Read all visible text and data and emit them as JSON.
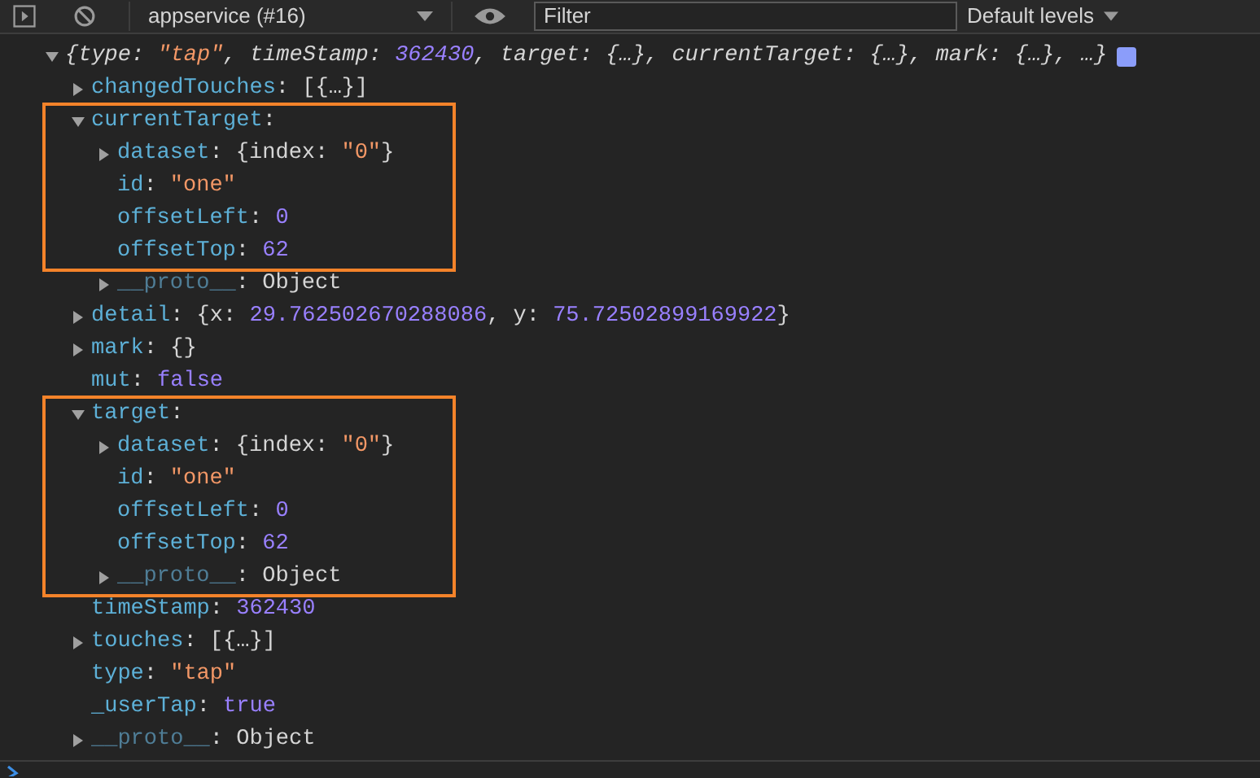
{
  "toolbar": {
    "context": "appservice (#16)",
    "filter": {
      "placeholder": "Filter"
    },
    "levels": "Default levels"
  },
  "entry": {
    "expanded": true,
    "summary": [
      {
        "kind": "punct",
        "text": "{"
      },
      {
        "kind": "key",
        "text": "type"
      },
      {
        "kind": "punct",
        "text": ": "
      },
      {
        "kind": "string",
        "text": "\"tap\""
      },
      {
        "kind": "punct",
        "text": ", "
      },
      {
        "kind": "key",
        "text": "timeStamp"
      },
      {
        "kind": "punct",
        "text": ": "
      },
      {
        "kind": "number",
        "text": "362430"
      },
      {
        "kind": "punct",
        "text": ", "
      },
      {
        "kind": "key",
        "text": "target"
      },
      {
        "kind": "punct",
        "text": ": {…}, "
      },
      {
        "kind": "key",
        "text": "currentTarget"
      },
      {
        "kind": "punct",
        "text": ": {…}, "
      },
      {
        "kind": "key",
        "text": "mark"
      },
      {
        "kind": "punct",
        "text": ": {…}, …}"
      }
    ],
    "properties": [
      {
        "kind": "object",
        "expanded": false,
        "boxed": false,
        "tokens": [
          {
            "kind": "key",
            "text": "changedTouches"
          },
          {
            "kind": "punct",
            "text": ": [{…}]"
          }
        ]
      },
      {
        "kind": "object",
        "expanded": true,
        "boxed": true,
        "tokens": [
          {
            "kind": "key",
            "text": "currentTarget"
          },
          {
            "kind": "punct",
            "text": ":"
          }
        ],
        "children": [
          {
            "kind": "object",
            "expanded": false,
            "boxed": true,
            "tokens": [
              {
                "kind": "key",
                "text": "dataset"
              },
              {
                "kind": "punct",
                "text": ": {index: "
              },
              {
                "kind": "string",
                "text": "\"0\""
              },
              {
                "kind": "punct",
                "text": "}"
              }
            ]
          },
          {
            "kind": "primitive",
            "boxed": true,
            "tokens": [
              {
                "kind": "key",
                "text": "id"
              },
              {
                "kind": "punct",
                "text": ": "
              },
              {
                "kind": "string",
                "text": "\"one\""
              }
            ]
          },
          {
            "kind": "primitive",
            "boxed": true,
            "tokens": [
              {
                "kind": "key",
                "text": "offsetLeft"
              },
              {
                "kind": "punct",
                "text": ": "
              },
              {
                "kind": "number",
                "text": "0"
              }
            ]
          },
          {
            "kind": "primitive",
            "boxed": true,
            "tokens": [
              {
                "kind": "key",
                "text": "offsetTop"
              },
              {
                "kind": "punct",
                "text": ": "
              },
              {
                "kind": "number",
                "text": "62"
              }
            ]
          },
          {
            "kind": "object",
            "expanded": false,
            "boxed": false,
            "tokens": [
              {
                "kind": "internal",
                "text": "__proto__"
              },
              {
                "kind": "punct",
                "text": ": Object"
              }
            ]
          }
        ]
      },
      {
        "kind": "object",
        "expanded": false,
        "boxed": false,
        "tokens": [
          {
            "kind": "key",
            "text": "detail"
          },
          {
            "kind": "punct",
            "text": ": {x: "
          },
          {
            "kind": "number",
            "text": "29.762502670288086"
          },
          {
            "kind": "punct",
            "text": ", y: "
          },
          {
            "kind": "number",
            "text": "75.72502899169922"
          },
          {
            "kind": "punct",
            "text": "}"
          }
        ]
      },
      {
        "kind": "object",
        "expanded": false,
        "boxed": false,
        "tokens": [
          {
            "kind": "key",
            "text": "mark"
          },
          {
            "kind": "punct",
            "text": ": {}"
          }
        ]
      },
      {
        "kind": "primitive",
        "boxed": false,
        "tokens": [
          {
            "kind": "key",
            "text": "mut"
          },
          {
            "kind": "punct",
            "text": ": "
          },
          {
            "kind": "number",
            "text": "false"
          }
        ]
      },
      {
        "kind": "object",
        "expanded": true,
        "boxed": true,
        "tokens": [
          {
            "kind": "key",
            "text": "target"
          },
          {
            "kind": "punct",
            "text": ":"
          }
        ],
        "children": [
          {
            "kind": "object",
            "expanded": false,
            "boxed": true,
            "tokens": [
              {
                "kind": "key",
                "text": "dataset"
              },
              {
                "kind": "punct",
                "text": ": {index: "
              },
              {
                "kind": "string",
                "text": "\"0\""
              },
              {
                "kind": "punct",
                "text": "}"
              }
            ]
          },
          {
            "kind": "primitive",
            "boxed": true,
            "tokens": [
              {
                "kind": "key",
                "text": "id"
              },
              {
                "kind": "punct",
                "text": ": "
              },
              {
                "kind": "string",
                "text": "\"one\""
              }
            ]
          },
          {
            "kind": "primitive",
            "boxed": true,
            "tokens": [
              {
                "kind": "key",
                "text": "offsetLeft"
              },
              {
                "kind": "punct",
                "text": ": "
              },
              {
                "kind": "number",
                "text": "0"
              }
            ]
          },
          {
            "kind": "primitive",
            "boxed": true,
            "tokens": [
              {
                "kind": "key",
                "text": "offsetTop"
              },
              {
                "kind": "punct",
                "text": ": "
              },
              {
                "kind": "number",
                "text": "62"
              }
            ]
          },
          {
            "kind": "object",
            "expanded": false,
            "boxed": true,
            "tokens": [
              {
                "kind": "internal",
                "text": "__proto__"
              },
              {
                "kind": "punct",
                "text": ": Object"
              }
            ]
          }
        ]
      },
      {
        "kind": "primitive",
        "boxed": false,
        "tokens": [
          {
            "kind": "key",
            "text": "timeStamp"
          },
          {
            "kind": "punct",
            "text": ": "
          },
          {
            "kind": "number",
            "text": "362430"
          }
        ]
      },
      {
        "kind": "object",
        "expanded": false,
        "boxed": false,
        "tokens": [
          {
            "kind": "key",
            "text": "touches"
          },
          {
            "kind": "punct",
            "text": ": [{…}]"
          }
        ]
      },
      {
        "kind": "primitive",
        "boxed": false,
        "tokens": [
          {
            "kind": "key",
            "text": "type"
          },
          {
            "kind": "punct",
            "text": ": "
          },
          {
            "kind": "string",
            "text": "\"tap\""
          }
        ]
      },
      {
        "kind": "primitive",
        "boxed": false,
        "tokens": [
          {
            "kind": "key",
            "text": "_userTap"
          },
          {
            "kind": "punct",
            "text": ": "
          },
          {
            "kind": "number",
            "text": "true"
          }
        ]
      },
      {
        "kind": "object",
        "expanded": false,
        "boxed": false,
        "tokens": [
          {
            "kind": "internal",
            "text": "__proto__"
          },
          {
            "kind": "punct",
            "text": ": Object"
          }
        ]
      }
    ]
  }
}
